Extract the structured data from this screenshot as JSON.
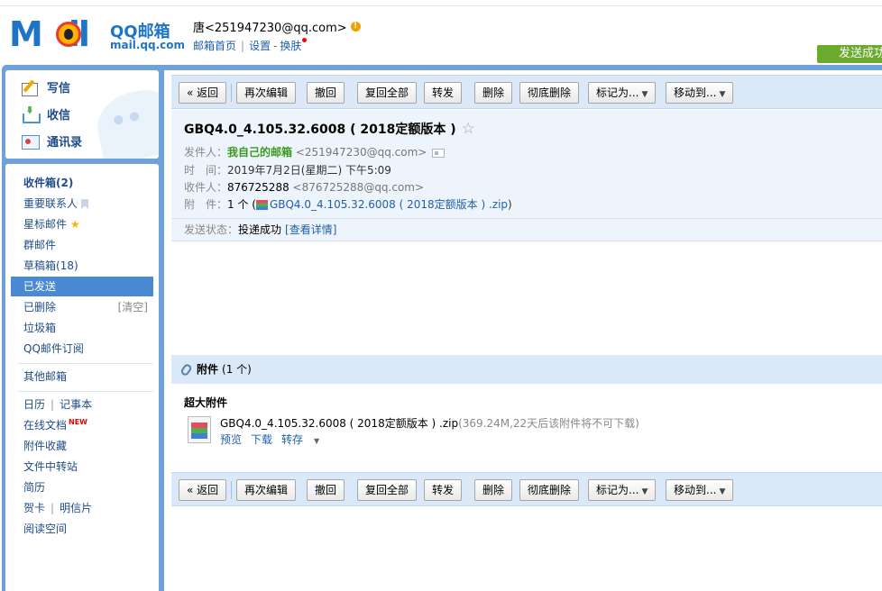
{
  "header": {
    "logo_text": "M",
    "logo_tail": "il",
    "brand": "QQ邮箱",
    "domain": "mail.qq.com",
    "user": "唐<251947230@qq.com>",
    "links": {
      "home": "邮箱首页",
      "settings": "设置",
      "dash": "-",
      "skin": "换肤"
    },
    "send_success": "发送成功"
  },
  "sidebar": {
    "quick": {
      "write": "写信",
      "inbox": "收信",
      "contacts": "通讯录"
    },
    "folders": {
      "inbox": "收件箱(2)",
      "vip": "重要联系人",
      "starred": "星标邮件",
      "group": "群邮件",
      "drafts": "草稿箱(18)",
      "sent": "已发送",
      "deleted": "已删除",
      "clear": "[清空]",
      "spam": "垃圾箱",
      "subscribe": "QQ邮件订阅",
      "other": "其他邮箱",
      "calendar": "日历",
      "notes": "记事本",
      "docs": "在线文档",
      "new_badge": "NEW",
      "att_fav": "附件收藏",
      "transfer": "文件中转站",
      "resume": "简历",
      "card": "贺卡",
      "postcard": "明信片",
      "reading": "阅读空间"
    }
  },
  "toolbar": {
    "back": "« 返回",
    "resend": "再次编辑",
    "recall": "撤回",
    "reply_all": "复回全部",
    "forward": "转发",
    "delete": "删除",
    "delete_perm": "彻底删除",
    "mark_as": "标记为...",
    "move_to": "移动到..."
  },
  "mail": {
    "subject": "GBQ4.0_4.105.32.6008 ( 2018定额版本 )",
    "from_label": "发件人：",
    "from_name": "我自己的邮箱",
    "from_addr": "<251947230@qq.com>",
    "time_label": "时　间：",
    "time": "2019年7月2日(星期二) 下午5:09",
    "to_label": "收件人：",
    "to_name": "876725288",
    "to_addr": "<876725288@qq.com>",
    "att_label": "附　件：",
    "att_count": "1 个 (",
    "att_name": "GBQ4.0_4.105.32.6008 ( 2018定额版本 ) .zip",
    "att_close": ")",
    "status_label": "发送状态：",
    "status": "投递成功",
    "status_link": "[查看详情]"
  },
  "attachments": {
    "title": "附件",
    "count": "(1 个)",
    "super_title": "超大附件",
    "file_name": "GBQ4.0_4.105.32.6008 ( 2018定额版本 ) .zip",
    "file_meta": "(369.24M,22天后该附件将不可下载)",
    "preview": "预览",
    "download": "下载",
    "save_to": "转存"
  },
  "colors": {
    "brand_blue": "#1f75c5",
    "frame_blue": "#6ea1d9",
    "selected": "#4a8ad4",
    "success_green": "#6aaa2c"
  }
}
